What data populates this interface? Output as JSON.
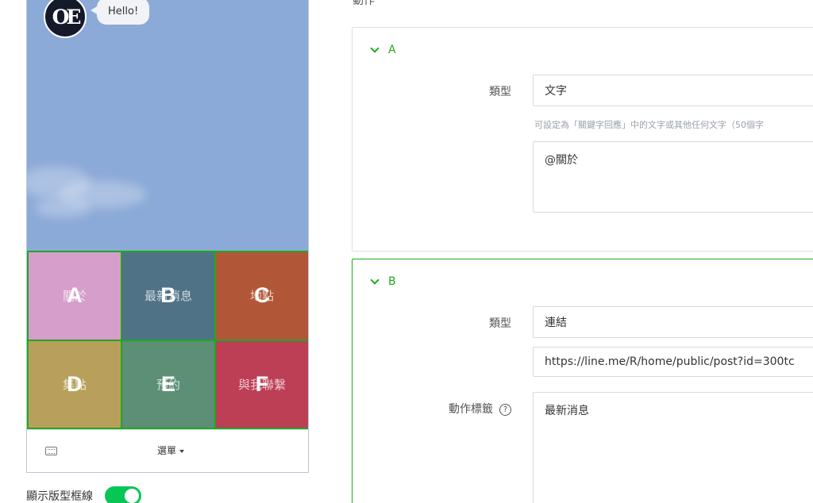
{
  "preview": {
    "bubble_text": "Hello!",
    "avatar_mark": "OE",
    "cells": [
      {
        "letter": "A",
        "label": "關於",
        "color": "#d59ecb"
      },
      {
        "letter": "B",
        "label": "最新消息",
        "color": "#4f7286"
      },
      {
        "letter": "C",
        "label": "地點",
        "color": "#b15738"
      },
      {
        "letter": "D",
        "label": "集點",
        "color": "#b8a05c"
      },
      {
        "letter": "E",
        "label": "預約",
        "color": "#5c8f75"
      },
      {
        "letter": "F",
        "label": "與我聯繫",
        "color": "#bc3f56"
      }
    ],
    "menu_bar_label": "選單",
    "show_border_label": "顯示版型框線",
    "show_border_on": true
  },
  "settings": {
    "section_title": "動作",
    "actions": [
      {
        "letter": "A",
        "type_label": "類型",
        "type_value": "文字",
        "hint": "可設定為「關鍵字回應」中的文字或其他任何文字（50個字",
        "text_value": "@關於"
      },
      {
        "letter": "B",
        "type_label": "類型",
        "type_value": "連結",
        "url_value": "https://line.me/R/home/public/post?id=300tc",
        "action_label_label": "動作標籤",
        "action_label_value": "最新消息",
        "help_symbol": "?"
      }
    ]
  },
  "colors": {
    "accent": "#1fa81f",
    "toggle_on": "#06c755",
    "chat_bg": "#8caad8"
  }
}
